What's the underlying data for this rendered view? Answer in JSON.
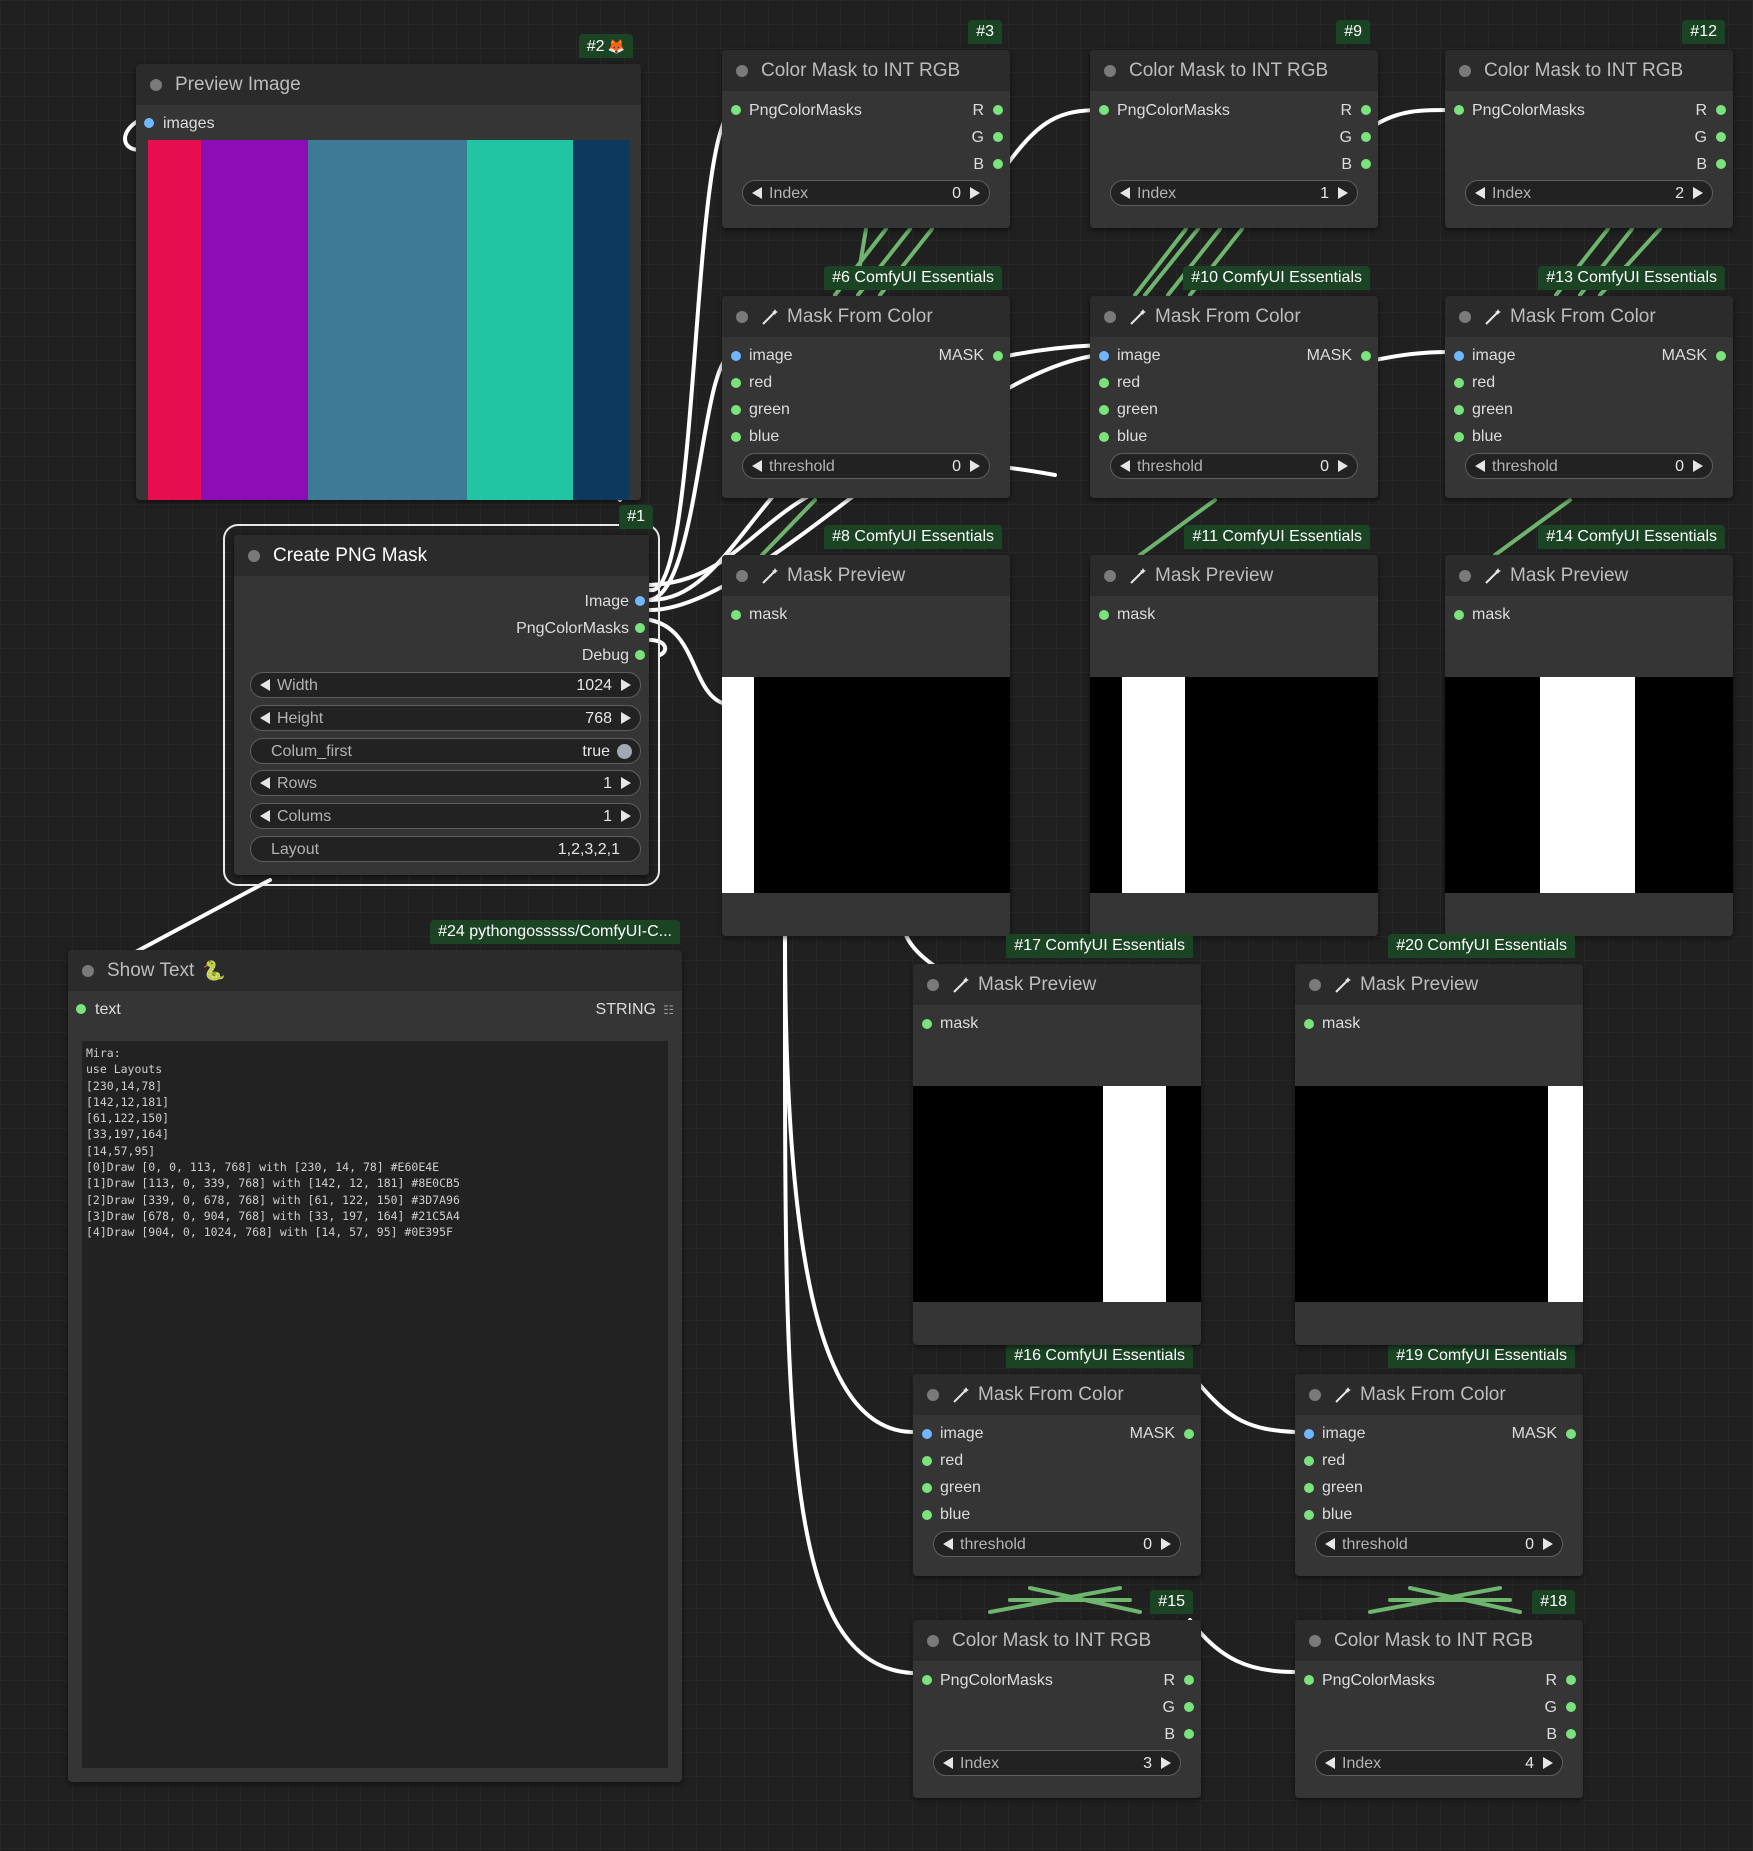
{
  "colors": {
    "canvas": "#202020",
    "node_body": "#353535",
    "node_header": "#2b2b2b",
    "badge_bg": "#1a4424",
    "slot_green": "#7be37b",
    "slot_blue": "#6fb7ff",
    "wire": "#ffffff",
    "wire_mask": "#7ccf7c"
  },
  "nodes": {
    "preview_image": {
      "badge": "#2",
      "badge_icon": "fox-icon",
      "title": "Preview Image",
      "input": "images",
      "stripe_colors": [
        "#E60E4E",
        "#8E0CB5",
        "#3D7A96",
        "#21C5A4",
        "#0E395F"
      ]
    },
    "create_png_mask": {
      "badge": "#1",
      "title": "Create PNG Mask",
      "outputs": [
        "Image",
        "PngColorMasks",
        "Debug"
      ],
      "widgets": {
        "width": {
          "label": "Width",
          "value": "1024"
        },
        "height": {
          "label": "Height",
          "value": "768"
        },
        "colum_first": {
          "label": "Colum_first",
          "value": "true"
        },
        "rows": {
          "label": "Rows",
          "value": "1"
        },
        "colums": {
          "label": "Colums",
          "value": "1"
        },
        "layout": {
          "label": "Layout",
          "value": "1,2,3,2,1"
        }
      }
    },
    "show_text": {
      "badge": "#24 pythongosssss/ComfyUI-C...",
      "badge_icon": "snake-icon",
      "title": "Show Text",
      "input": "text",
      "output": "STRING",
      "output_icon": "grid-icon",
      "content": "Mira:\nuse Layouts\n[230,14,78]\n[142,12,181]\n[61,122,150]\n[33,197,164]\n[14,57,95]\n[0]Draw [0, 0, 113, 768] with [230, 14, 78] #E60E4E\n[1]Draw [113, 0, 339, 768] with [142, 12, 181] #8E0CB5\n[2]Draw [339, 0, 678, 768] with [61, 122, 150] #3D7A96\n[3]Draw [678, 0, 904, 768] with [33, 197, 164] #21C5A4\n[4]Draw [904, 0, 1024, 768] with [14, 57, 95] #0E395F"
    },
    "color_mask_3": {
      "badge": "#3",
      "title": "Color Mask to INT RGB",
      "input": "PngColorMasks",
      "outputs": [
        "R",
        "G",
        "B"
      ],
      "index_label": "Index",
      "index_value": "0"
    },
    "color_mask_9": {
      "badge": "#9",
      "title": "Color Mask to INT RGB",
      "input": "PngColorMasks",
      "outputs": [
        "R",
        "G",
        "B"
      ],
      "index_label": "Index",
      "index_value": "1"
    },
    "color_mask_12": {
      "badge": "#12",
      "title": "Color Mask to INT RGB",
      "input": "PngColorMasks",
      "outputs": [
        "R",
        "G",
        "B"
      ],
      "index_label": "Index",
      "index_value": "2"
    },
    "color_mask_15": {
      "badge": "#15",
      "title": "Color Mask to INT RGB",
      "input": "PngColorMasks",
      "outputs": [
        "R",
        "G",
        "B"
      ],
      "index_label": "Index",
      "index_value": "3"
    },
    "color_mask_18": {
      "badge": "#18",
      "title": "Color Mask to INT RGB",
      "input": "PngColorMasks",
      "outputs": [
        "R",
        "G",
        "B"
      ],
      "index_label": "Index",
      "index_value": "4"
    },
    "mask_from_color_6": {
      "badge": "#6 ComfyUI Essentials",
      "title": "Mask From Color",
      "inputs": [
        "image",
        "red",
        "green",
        "blue"
      ],
      "output": "MASK",
      "threshold_label": "threshold",
      "threshold_value": "0"
    },
    "mask_from_color_10": {
      "badge": "#10 ComfyUI Essentials",
      "title": "Mask From Color",
      "inputs": [
        "image",
        "red",
        "green",
        "blue"
      ],
      "output": "MASK",
      "threshold_label": "threshold",
      "threshold_value": "0"
    },
    "mask_from_color_13": {
      "badge": "#13 ComfyUI Essentials",
      "title": "Mask From Color",
      "inputs": [
        "image",
        "red",
        "green",
        "blue"
      ],
      "output": "MASK",
      "threshold_label": "threshold",
      "threshold_value": "0"
    },
    "mask_from_color_16": {
      "badge": "#16 ComfyUI Essentials",
      "title": "Mask From Color",
      "inputs": [
        "image",
        "red",
        "green",
        "blue"
      ],
      "output": "MASK",
      "threshold_label": "threshold",
      "threshold_value": "0"
    },
    "mask_from_color_19": {
      "badge": "#19 ComfyUI Essentials",
      "title": "Mask From Color",
      "inputs": [
        "image",
        "red",
        "green",
        "blue"
      ],
      "output": "MASK",
      "threshold_label": "threshold",
      "threshold_value": "0"
    },
    "mask_preview_8": {
      "badge": "#8 ComfyUI Essentials",
      "title": "Mask Preview",
      "input": "mask",
      "mask_fraction": [
        0.0,
        0.11
      ]
    },
    "mask_preview_11": {
      "badge": "#11 ComfyUI Essentials",
      "title": "Mask Preview",
      "input": "mask",
      "mask_fraction": [
        0.11,
        0.33
      ]
    },
    "mask_preview_14": {
      "badge": "#14 ComfyUI Essentials",
      "title": "Mask Preview",
      "input": "mask",
      "mask_fraction": [
        0.33,
        0.66
      ]
    },
    "mask_preview_17": {
      "badge": "#17 ComfyUI Essentials",
      "title": "Mask Preview",
      "input": "mask",
      "mask_fraction": [
        0.66,
        0.88
      ]
    },
    "mask_preview_20": {
      "badge": "#20 ComfyUI Essentials",
      "title": "Mask Preview",
      "input": "mask",
      "mask_fraction": [
        0.88,
        1.0
      ]
    }
  }
}
